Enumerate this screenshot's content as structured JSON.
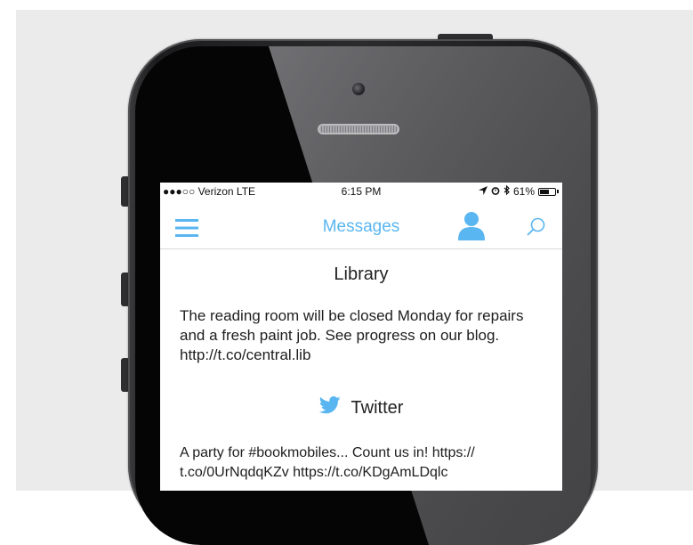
{
  "status_bar": {
    "carrier": "●●●○○ Verizon  LTE",
    "time": "6:15 PM",
    "battery": "61%",
    "battery_level": 0.61
  },
  "nav": {
    "title": "Messages",
    "accent_color": "#5ab6f0",
    "menu_icon": "hamburger-menu-icon",
    "profile_icon": "user-profile-icon",
    "search_icon": "search-icon"
  },
  "feed": [
    {
      "source": "Library",
      "text": "The reading room will be closed Monday for repairs and a fresh paint job. See progress on our blog. http://t.co/central.lib"
    },
    {
      "source": "Twitter",
      "icon": "twitter-bird-icon",
      "text": "A party for #bookmobiles... Count us in! https:// t.co/0UrNqdqKZv https://t.co/KDgAmLDqlc"
    }
  ]
}
